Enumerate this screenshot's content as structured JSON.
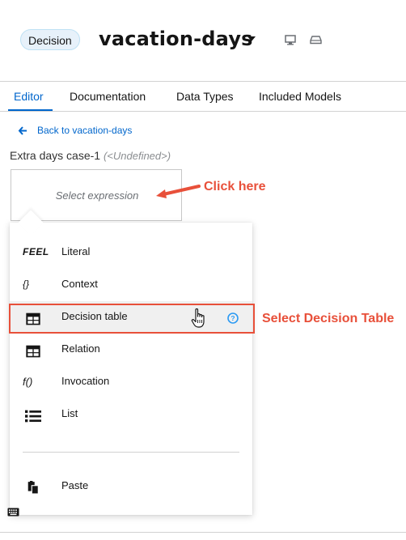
{
  "header": {
    "badge": "Decision",
    "title": "vacation-days",
    "icons": [
      "chevron-down-icon",
      "monitor-icon",
      "drive-icon"
    ]
  },
  "tabs": [
    {
      "label": "Editor",
      "active": true
    },
    {
      "label": "Documentation",
      "active": false
    },
    {
      "label": "Data Types",
      "active": false
    },
    {
      "label": "Included Models",
      "active": false
    }
  ],
  "back_link": "Back to vacation-days",
  "expression": {
    "name": "Extra days case-1",
    "type": "(<Undefined>)",
    "placeholder": "Select expression"
  },
  "menu": {
    "items": [
      {
        "icon_text": "FEEL",
        "icon": "feel-icon",
        "label": "Literal"
      },
      {
        "icon_text": "{}",
        "icon": "braces-icon",
        "label": "Context"
      },
      {
        "icon_text": "",
        "icon": "table-icon",
        "label": "Decision table"
      },
      {
        "icon_text": "",
        "icon": "table-icon",
        "label": "Relation"
      },
      {
        "icon_text": "f()",
        "icon": "function-icon",
        "label": "Invocation"
      },
      {
        "icon_text": "",
        "icon": "list-icon",
        "label": "List"
      }
    ],
    "paste": {
      "icon": "paste-icon",
      "label": "Paste"
    }
  },
  "annotations": {
    "click_here": "Click here",
    "select_decision_table": "Select Decision Table",
    "color": "#e8503a"
  },
  "colors": {
    "accent": "#0066cc",
    "annotation": "#e8503a"
  }
}
